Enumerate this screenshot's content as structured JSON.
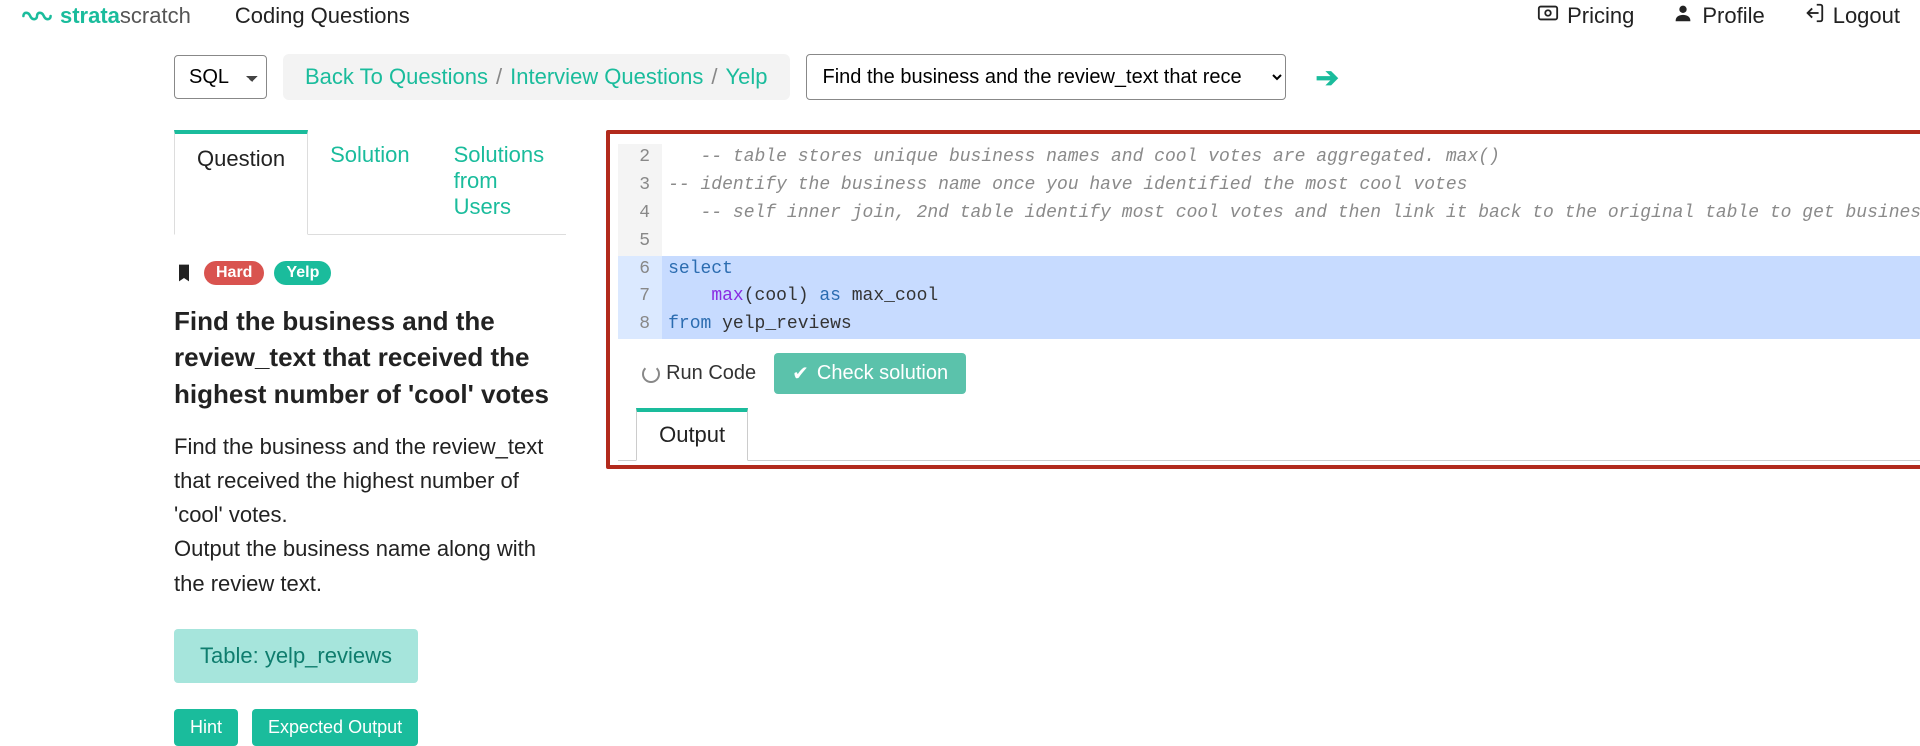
{
  "brand": {
    "first": "strata",
    "second": "scratch"
  },
  "topbar": {
    "title": "Coding Questions",
    "pricing": "Pricing",
    "profile": "Profile",
    "logout": "Logout"
  },
  "toolbar": {
    "lang_options": [
      "SQL"
    ],
    "lang_selected": "SQL",
    "crumbs": [
      "Back To Questions",
      "Interview Questions",
      "Yelp"
    ],
    "question_select_label": "Find the business and the review_text that received th"
  },
  "tabs": {
    "question": "Question",
    "solution": "Solution",
    "solutions_from_users": "Solutions from Users",
    "active": "question"
  },
  "question": {
    "difficulty": "Hard",
    "company": "Yelp",
    "title": "Find the business and the review_text that received the highest number of 'cool' votes",
    "description_line1": "Find the business and the review_text that received the highest number of  'cool' votes.",
    "description_line2": "Output the business name along with the review text.",
    "table_button": "Table: yelp_reviews",
    "hint_button": "Hint",
    "expected_output_button": "Expected Output"
  },
  "editor": {
    "lines": [
      {
        "n": 2,
        "kind": "comment",
        "text": "   -- table stores unique business names and cool votes are aggregated. max()"
      },
      {
        "n": 3,
        "kind": "comment",
        "text": "-- identify the business name once you have identified the most cool votes"
      },
      {
        "n": 4,
        "kind": "comment",
        "text": "   -- self inner join, 2nd table identify most cool votes and then link it back to the original table to get business name and review text"
      },
      {
        "n": 5,
        "kind": "blank",
        "text": ""
      },
      {
        "n": 6,
        "kind": "sql",
        "text": "select",
        "selected": true
      },
      {
        "n": 7,
        "kind": "sql",
        "text": "    max(cool) as max_cool",
        "selected": true
      },
      {
        "n": 8,
        "kind": "sql",
        "text": "from yelp_reviews",
        "selected": true
      }
    ],
    "run_label": "Run Code",
    "check_label": "Check solution",
    "output_tab": "Output"
  }
}
